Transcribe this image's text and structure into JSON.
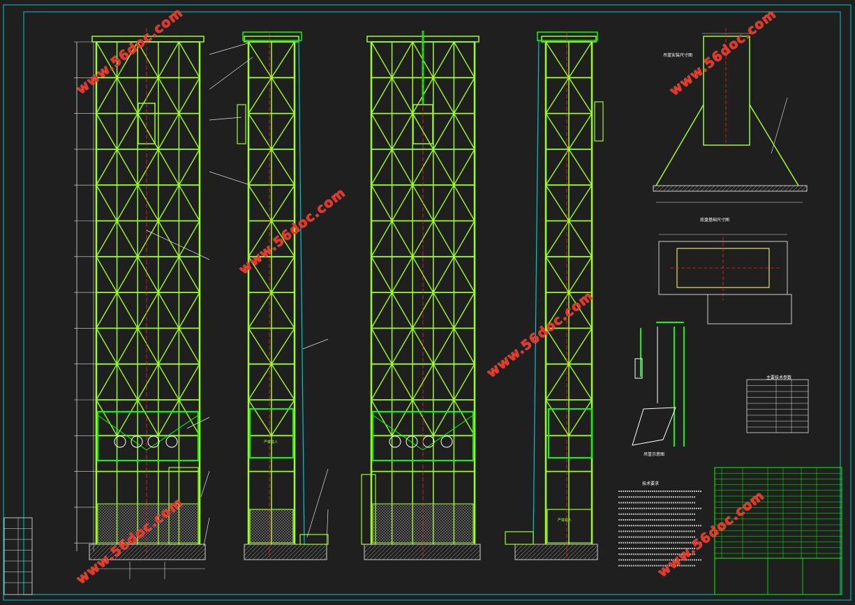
{
  "watermark": {
    "text": "www.56doc.com",
    "color": "#ff2a1a"
  },
  "colors": {
    "background": "#1f1f1f",
    "frame": "#00c8c8",
    "structure": "#9eff1e",
    "structure_bright": "#00ff00",
    "centerline": "#ff2020",
    "dimension": "#e0e0e0",
    "mesh": "#9a9a9a"
  },
  "views": [
    "front-elevation",
    "side-elevation-left",
    "rear-elevation",
    "side-elevation-right"
  ],
  "detail_titles": {
    "top": "吊篮安装尺寸图",
    "middle": "底盘基础尺寸图",
    "bottom": "吊篮示意图",
    "params": "主要技术参数",
    "notes": "技术要求"
  },
  "cage_labels": [
    "严禁载人",
    "严禁载人"
  ]
}
